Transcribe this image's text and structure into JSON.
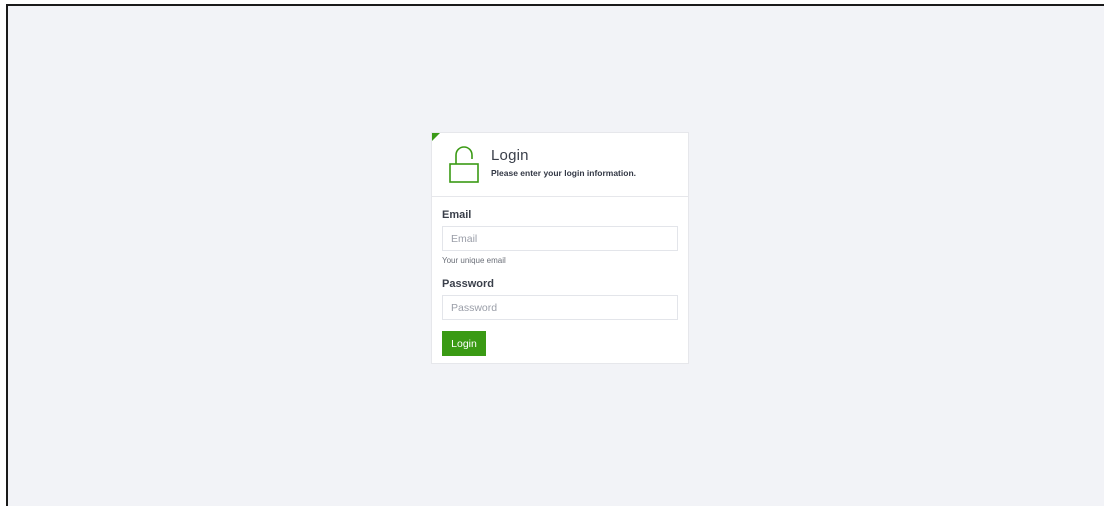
{
  "login_card": {
    "title": "Login",
    "subtitle": "Please enter your login information.",
    "icon": "unlocked-padlock-icon",
    "email": {
      "label": "Email",
      "placeholder": "Email",
      "value": "",
      "helper": "Your unique email"
    },
    "password": {
      "label": "Password",
      "placeholder": "Password",
      "value": ""
    },
    "submit_label": "Login"
  },
  "colors": {
    "accent": "#3a9a14",
    "background": "#f2f3f7",
    "card": "#ffffff"
  }
}
